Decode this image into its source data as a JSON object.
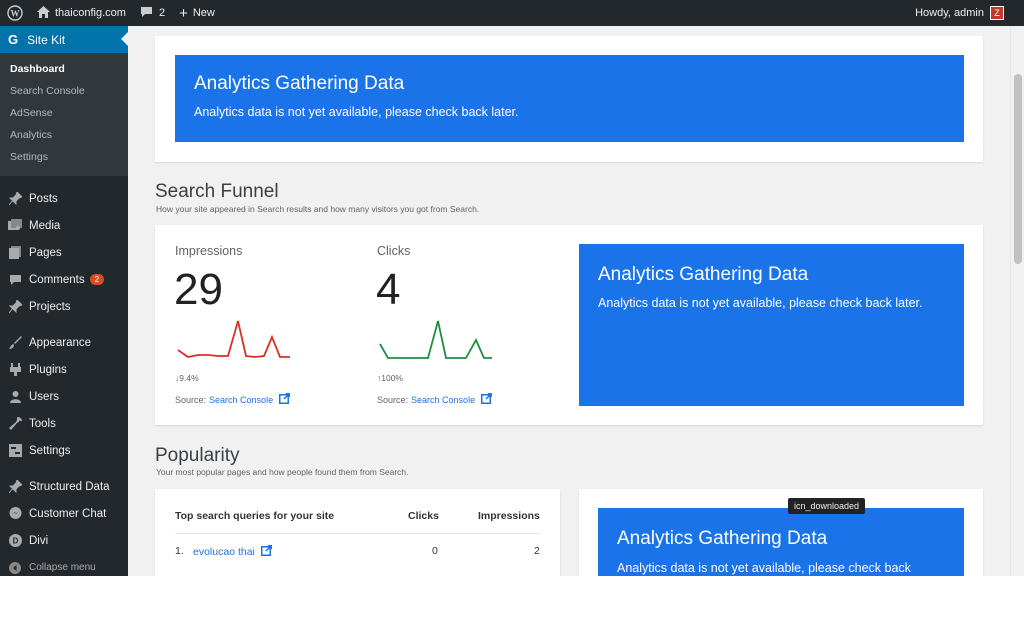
{
  "adminbar": {
    "site_name": "thaiconfig.com",
    "comments_count": "2",
    "new_label": "New",
    "greeting": "Howdy, admin"
  },
  "sidebar": {
    "plugin_title": "Site Kit",
    "submenu": [
      "Dashboard",
      "Search Console",
      "AdSense",
      "Analytics",
      "Settings"
    ],
    "menu": [
      {
        "label": "Posts",
        "icon": "pin-icon"
      },
      {
        "label": "Media",
        "icon": "media-icon"
      },
      {
        "label": "Pages",
        "icon": "pages-icon"
      },
      {
        "label": "Comments",
        "icon": "comments-icon",
        "badge": "2"
      },
      {
        "label": "Projects",
        "icon": "pin-icon"
      },
      {
        "label": "Appearance",
        "icon": "brush-icon"
      },
      {
        "label": "Plugins",
        "icon": "plugin-icon"
      },
      {
        "label": "Users",
        "icon": "users-icon"
      },
      {
        "label": "Tools",
        "icon": "wrench-icon"
      },
      {
        "label": "Settings",
        "icon": "settings-icon"
      },
      {
        "label": "Structured Data",
        "icon": "pin-icon"
      },
      {
        "label": "Customer Chat",
        "icon": "chat-icon"
      },
      {
        "label": "Divi",
        "icon": "divi-icon"
      }
    ],
    "collapse_label": "Collapse menu"
  },
  "top_notice": {
    "title": "Analytics Gathering Data",
    "message": "Analytics data is not yet available, please check back later."
  },
  "search_funnel": {
    "title": "Search Funnel",
    "subtitle": "How your site appeared in Search results and how many visitors you got from Search.",
    "impressions": {
      "label": "Impressions",
      "value": "29",
      "delta": "9.4%",
      "delta_direction": "down",
      "source_prefix": "Source:",
      "source_link": "Search Console"
    },
    "clicks": {
      "label": "Clicks",
      "value": "4",
      "delta": "100%",
      "delta_direction": "up",
      "source_prefix": "Source:",
      "source_link": "Search Console"
    },
    "analytics_title": "Analytics Gathering Data",
    "analytics_message": "Analytics data is not yet available, please check back later."
  },
  "popularity": {
    "title": "Popularity",
    "subtitle": "Your most popular pages and how people found them from Search.",
    "table": {
      "headers": [
        "Top search queries for your site",
        "Clicks",
        "Impressions"
      ],
      "rows": [
        {
          "index": "1.",
          "query": "evolucao thai",
          "clicks": "0",
          "impressions": "2"
        }
      ]
    },
    "analytics_title": "Analytics Gathering Data",
    "analytics_message": "Analytics data is not yet available, please check back"
  },
  "tooltip": "icn_downloaded",
  "colors": {
    "accent_blue": "#1a73e8",
    "admin_dark": "#23282d",
    "sidebar_active": "#0073aa",
    "sparkline_red": "#d93025",
    "sparkline_green": "#1e8e3e"
  }
}
